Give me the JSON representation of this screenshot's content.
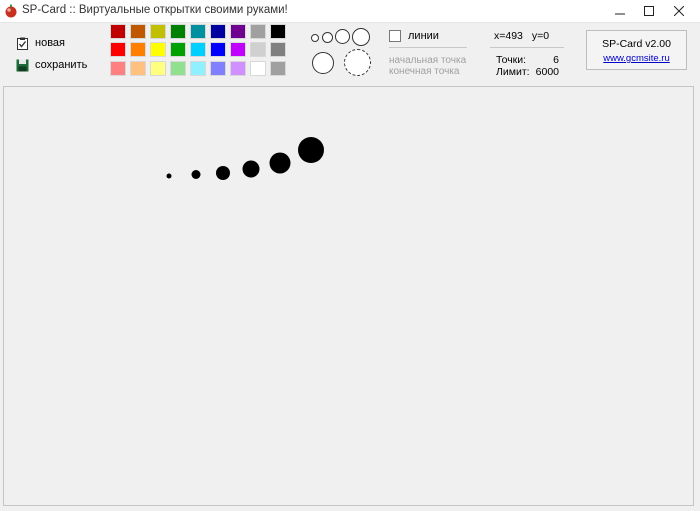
{
  "window": {
    "title": "SP-Card :: Виртуальные открытки своими руками!"
  },
  "toolbar": {
    "new_label": "новая",
    "save_label": "сохранить"
  },
  "palette": {
    "rows": [
      [
        "#c00000",
        "#c05800",
        "#c0c000",
        "#008000",
        "#0090a0",
        "#0000a0",
        "#700090",
        "#a0a0a0",
        "#000000"
      ],
      [
        "#ff0000",
        "#ff8000",
        "#ffff00",
        "#00a000",
        "#00d0ff",
        "#0000ff",
        "#c000ff",
        "#d0d0d0",
        "#808080"
      ],
      [
        "#ff8080",
        "#ffc080",
        "#ffff80",
        "#90e090",
        "#90f0ff",
        "#8080ff",
        "#d090ff",
        "#ffffff",
        "#a0a0a0"
      ]
    ]
  },
  "brushes": {
    "sizes": [
      "tiny",
      "small",
      "medium",
      "large",
      "extra-large",
      "eraser-dashed"
    ]
  },
  "options": {
    "lines_label": "линии",
    "lines_checked": false,
    "start_point_label": "начальная точка",
    "end_point_label": "конечная точка"
  },
  "coords": {
    "x_text": "x=493",
    "y_text": "y=0"
  },
  "stats": {
    "points_label": "Точки:",
    "points_value": "6",
    "limit_label": "Лимит:",
    "limit_value": "6000"
  },
  "about": {
    "version": "SP-Card v2.00",
    "link": "www.gcmsite.ru"
  },
  "canvas": {
    "background": "#f0f0f0",
    "dot_color": "#000000",
    "points_count": 6
  }
}
